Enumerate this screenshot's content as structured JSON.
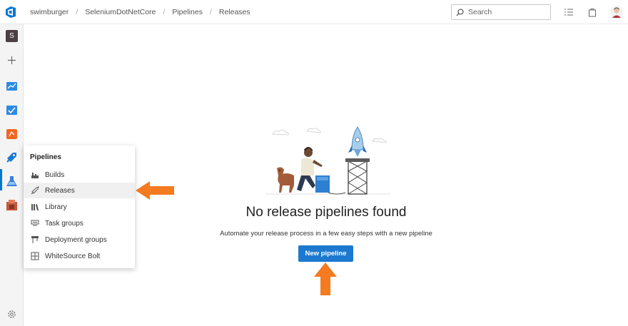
{
  "breadcrumb": [
    "swimburger",
    "SeleniumDotNetCore",
    "Pipelines",
    "Releases"
  ],
  "search": {
    "placeholder": "Search"
  },
  "rail": {
    "project_initial": "S",
    "items": [
      "add-icon",
      "boards-icon",
      "repos-icon",
      "artifacts-icon",
      "pipelines-icon",
      "test-plans-icon",
      "whitesource-icon"
    ]
  },
  "flyout": {
    "title": "Pipelines",
    "items": [
      {
        "label": "Builds",
        "icon": "builds-icon"
      },
      {
        "label": "Releases",
        "icon": "releases-icon",
        "selected": true
      },
      {
        "label": "Library",
        "icon": "library-icon"
      },
      {
        "label": "Task groups",
        "icon": "task-groups-icon"
      },
      {
        "label": "Deployment groups",
        "icon": "deployment-groups-icon"
      },
      {
        "label": "WhiteSource Bolt",
        "icon": "whitesource-bolt-icon"
      }
    ]
  },
  "main": {
    "empty_title": "No release pipelines found",
    "empty_subtitle": "Automate your release process in a few easy steps with a new pipeline",
    "new_pipeline_label": "New pipeline"
  },
  "colors": {
    "accent": "#0078d4",
    "annotation_arrow": "#f47b20",
    "button": "#1c79cf"
  }
}
